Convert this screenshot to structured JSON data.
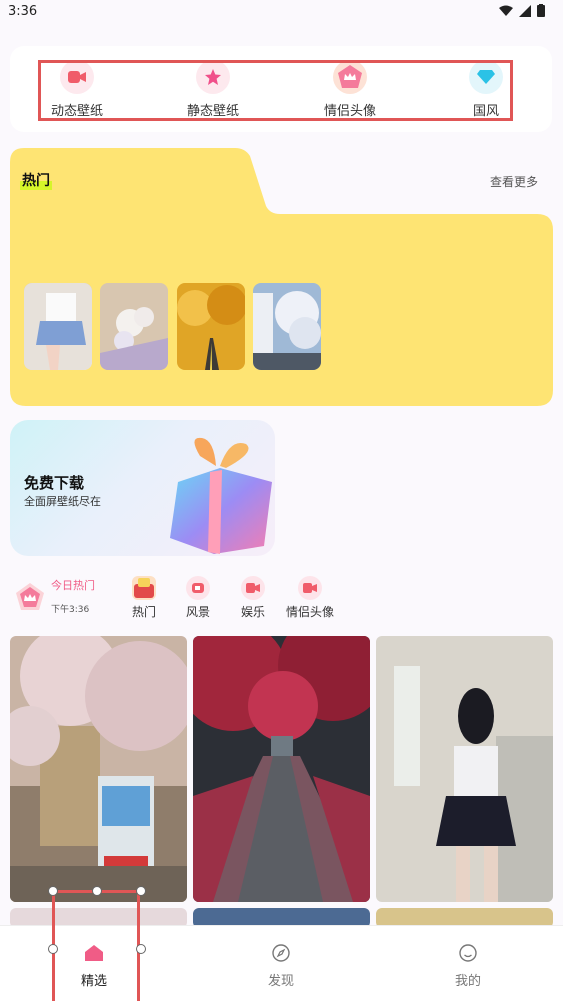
{
  "status": {
    "time": "3:36"
  },
  "top_categories": [
    {
      "label": "动态壁纸",
      "icon": "video-icon"
    },
    {
      "label": "静态壁纸",
      "icon": "star-icon"
    },
    {
      "label": "情侣头像",
      "icon": "crown-icon"
    },
    {
      "label": "国风",
      "icon": "diamond-icon"
    }
  ],
  "hot": {
    "title": "热门",
    "more": "查看更多"
  },
  "promo": {
    "title": "免费下载",
    "subtitle": "全面屏壁纸尽在"
  },
  "today": {
    "title": "今日热门",
    "time": "下午3:36"
  },
  "tags": [
    {
      "label": "热门",
      "icon": "hot-icon"
    },
    {
      "label": "风景",
      "icon": "landscape-icon"
    },
    {
      "label": "娱乐",
      "icon": "entertainment-icon"
    },
    {
      "label": "情侣头像",
      "icon": "couple-icon"
    }
  ],
  "grid": [
    {
      "name": "cherry-blossom-street",
      "colors": [
        "#d8c4c2",
        "#8a7567",
        "#c9bfa9"
      ]
    },
    {
      "name": "red-maple-path",
      "colors": [
        "#8c2b3f",
        "#2e3438",
        "#b45566"
      ]
    },
    {
      "name": "girl-mirror-selfie",
      "colors": [
        "#dcd8cf",
        "#20202c",
        "#a9a9a0"
      ]
    }
  ],
  "nav": [
    {
      "label": "精选",
      "icon": "home-icon",
      "active": true
    },
    {
      "label": "发现",
      "icon": "compass-icon",
      "active": false
    },
    {
      "label": "我的",
      "icon": "smile-icon",
      "active": false
    }
  ],
  "colors": {
    "hot_bg": "#fee473",
    "highlight": "#e05656",
    "accent_pink": "#f05c86"
  }
}
